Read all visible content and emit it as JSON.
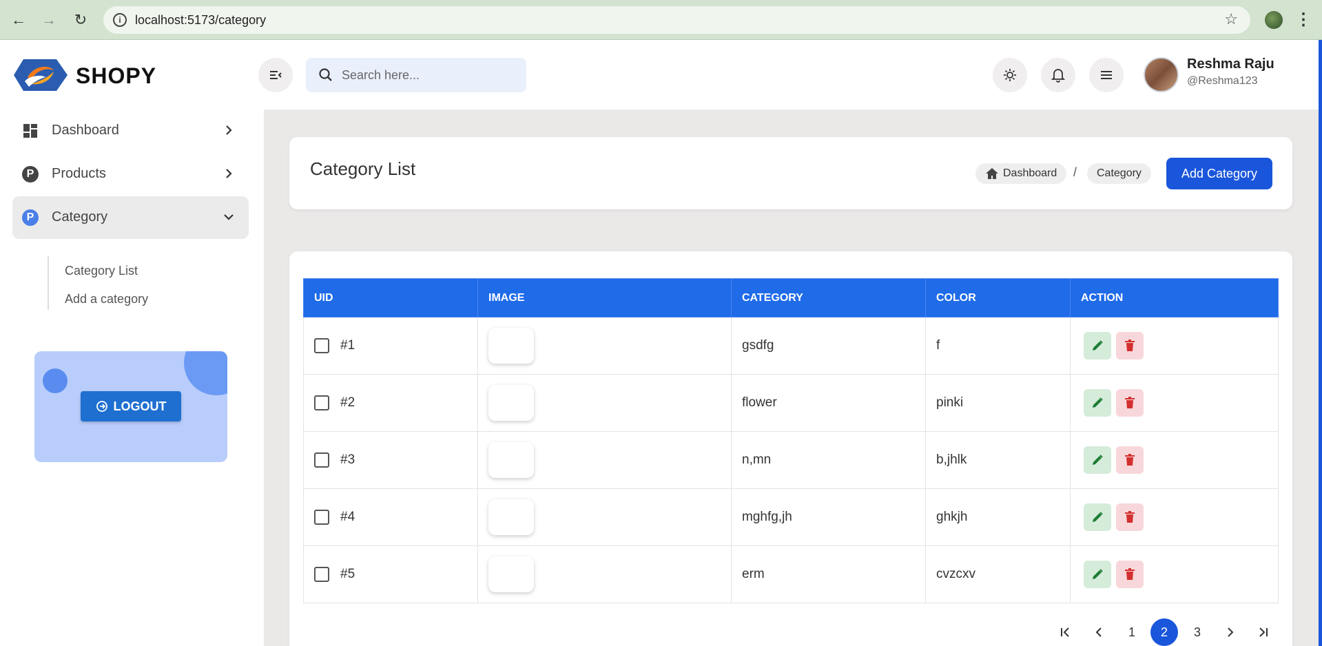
{
  "browser": {
    "url": "localhost:5173/category"
  },
  "header": {
    "brand": "SHOPY",
    "search_placeholder": "Search here...",
    "user": {
      "name": "Reshma Raju",
      "handle": "@Reshma123"
    }
  },
  "sidebar": {
    "items": [
      {
        "label": "Dashboard"
      },
      {
        "label": "Products"
      },
      {
        "label": "Category"
      }
    ],
    "subitems": [
      {
        "label": "Category List"
      },
      {
        "label": "Add a category"
      }
    ],
    "logout_label": "LOGOUT"
  },
  "page": {
    "title": "Category List",
    "breadcrumb": [
      "Dashboard",
      "Category"
    ],
    "breadcrumb_sep": "/",
    "add_button": "Add Category"
  },
  "table": {
    "headers": [
      "UID",
      "IMAGE",
      "CATEGORY",
      "COLOR",
      "ACTION"
    ],
    "rows": [
      {
        "uid": "#1",
        "category": "gsdfg",
        "color": "f"
      },
      {
        "uid": "#2",
        "category": "flower",
        "color": "pinki"
      },
      {
        "uid": "#3",
        "category": "n,mn",
        "color": "b,jhlk"
      },
      {
        "uid": "#4",
        "category": "mghfg,jh",
        "color": "ghkjh"
      },
      {
        "uid": "#5",
        "category": "erm",
        "color": "cvzcxv"
      }
    ]
  },
  "pagination": {
    "pages": [
      "1",
      "2",
      "3"
    ],
    "current": "2"
  },
  "colors": {
    "primary": "#1a56db",
    "table_header": "#1f6be8",
    "edit_bg": "#d4ecd9",
    "delete_bg": "#f8d7da"
  }
}
